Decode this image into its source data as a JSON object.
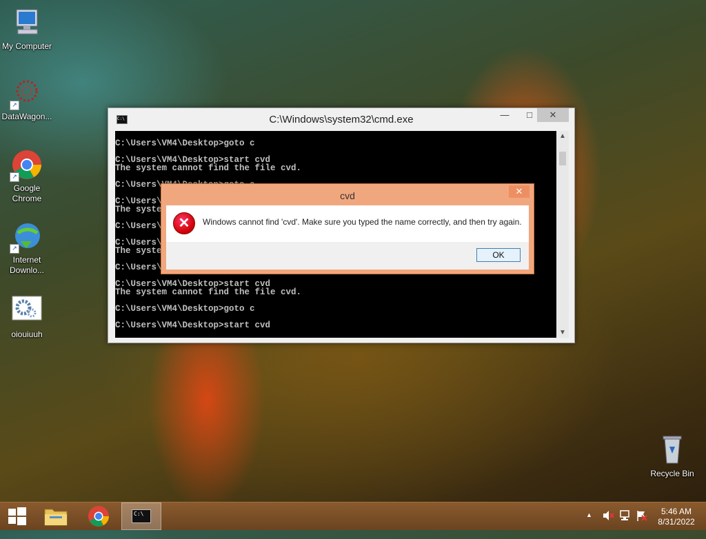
{
  "desktop": {
    "icons": [
      {
        "label": "My Computer"
      },
      {
        "label": "DataWagon..."
      },
      {
        "label": "Google Chrome"
      },
      {
        "label": "Internet Downlo..."
      },
      {
        "label": "oiouiuuh"
      },
      {
        "label": "Recycle Bin"
      }
    ]
  },
  "cmd_window": {
    "title": "C:\\Windows\\system32\\cmd.exe",
    "icon_text": "C:\\",
    "minimize": "—",
    "maximize": "□",
    "close": "✕",
    "console_text": "C:\\Users\\VM4\\Desktop>goto c\n\nC:\\Users\\VM4\\Desktop>start cvd\nThe system cannot find the file cvd.\n\nC:\\Users\\VM4\\Desktop>goto c\n\nC:\\Users\\VM4\\Desktop>start cvd\nThe system cannot find the file cvd.\n\nC:\\Users\\VM4\\Desktop>goto c\n\nC:\\Users\\VM4\\Desktop>start cvd\nThe system cannot find the file cvd.\n\nC:\\Users\\VM4\\Desktop>goto c\n\nC:\\Users\\VM4\\Desktop>start cvd\nThe system cannot find the file cvd.\n\nC:\\Users\\VM4\\Desktop>goto c\n\nC:\\Users\\VM4\\Desktop>start cvd"
  },
  "dialog": {
    "title": "cvd",
    "close": "✕",
    "message": "Windows cannot find 'cvd'. Make sure you typed the name correctly, and then try again.",
    "ok_label": "OK"
  },
  "taskbar": {
    "tray_up_arrow": "▲",
    "time": "5:46 AM",
    "date": "8/31/2022",
    "cmd_icon_text": "C:\\"
  },
  "colors": {
    "dialog_frame": "#f1a77e",
    "taskbar": "#7a4e26"
  }
}
